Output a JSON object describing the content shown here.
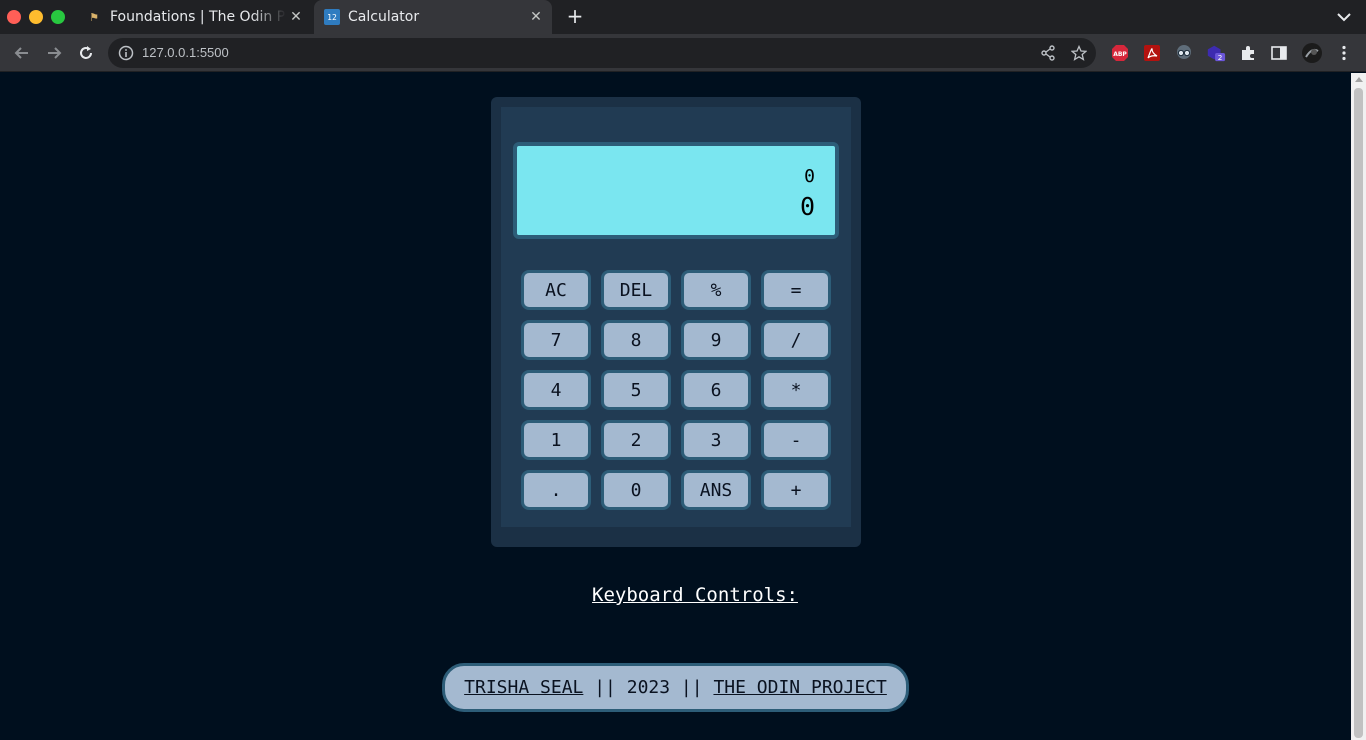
{
  "browser": {
    "tabs": [
      {
        "title": "Foundations | The Odin Project",
        "icon": "odin-project-favicon"
      },
      {
        "title": "Calculator",
        "icon": "calculator-favicon",
        "active": true
      }
    ],
    "url": "127.0.0.1:5500",
    "extension_badge": "2"
  },
  "calculator": {
    "display": {
      "previous": "0",
      "current": "0"
    },
    "keys": [
      "AC",
      "DEL",
      "%",
      "=",
      "7",
      "8",
      "9",
      "/",
      "4",
      "5",
      "6",
      "*",
      "1",
      "2",
      "3",
      "-",
      ".",
      "0",
      "ANS",
      "+"
    ]
  },
  "keyboard_controls": {
    "title": "Keyboard Controls:"
  },
  "footer": {
    "author": "TRISHA SEAL",
    "separator": " || ",
    "year": "2023",
    "project": "THE ODIN PROJECT"
  },
  "colors": {
    "page_bg": "#000f1e",
    "calc_body": "#1b3045",
    "calc_panel": "#213b53",
    "display_bg": "#7ae6f0",
    "key_bg": "#a4b9d0",
    "key_border": "#2d5d78"
  }
}
